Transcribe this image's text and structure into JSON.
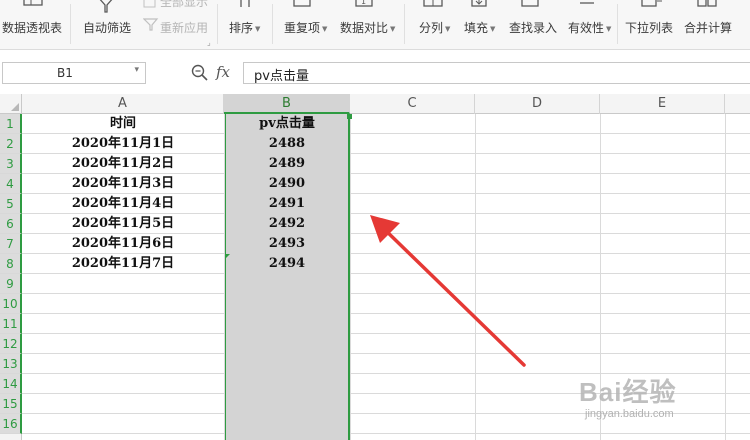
{
  "ribbon": {
    "items": [
      {
        "label": "数据透视表",
        "icon": "pivot-table-icon"
      },
      {
        "label": "自动筛选",
        "icon": "filter-icon"
      },
      {
        "label": "全部显示",
        "icon": "show-all-icon"
      },
      {
        "label": "重新应用",
        "icon": "reapply-filter-icon"
      },
      {
        "label": "排序",
        "icon": "sort-icon"
      },
      {
        "label": "重复项",
        "icon": "duplicates-icon"
      },
      {
        "label": "数据对比",
        "icon": "data-compare-icon"
      },
      {
        "label": "分列",
        "icon": "split-columns-icon"
      },
      {
        "label": "填充",
        "icon": "fill-icon"
      },
      {
        "label": "查找录入",
        "icon": "find-entry-icon"
      },
      {
        "label": "有效性",
        "icon": "validation-icon"
      },
      {
        "label": "下拉列表",
        "icon": "dropdown-list-icon"
      },
      {
        "label": "合并计算",
        "icon": "consolidate-icon"
      }
    ]
  },
  "formula_bar": {
    "cell_ref": "B1",
    "fx_label": "fx",
    "content": "pv点击量"
  },
  "columns": [
    "A",
    "B",
    "C",
    "D",
    "E"
  ],
  "rows": [
    "1",
    "2",
    "3",
    "4",
    "5",
    "6",
    "7",
    "8",
    "9",
    "10",
    "11",
    "12",
    "13",
    "14",
    "15",
    "16"
  ],
  "table": {
    "headers": {
      "A": "时间",
      "B": "pv点击量"
    },
    "rows": [
      {
        "A": "2020年11月1日",
        "B": "2488"
      },
      {
        "A": "2020年11月2日",
        "B": "2489"
      },
      {
        "A": "2020年11月3日",
        "B": "2490"
      },
      {
        "A": "2020年11月4日",
        "B": "2491"
      },
      {
        "A": "2020年11月5日",
        "B": "2492"
      },
      {
        "A": "2020年11月6日",
        "B": "2493"
      },
      {
        "A": "2020年11月7日",
        "B": "2494"
      }
    ]
  },
  "selected_column": "B",
  "watermark": {
    "brand": "Bai经验",
    "url": "jingyan.baidu.com"
  },
  "colors": {
    "accent": "#2e9b41",
    "arrow": "#e53935",
    "selection": "#d4d4d4"
  }
}
